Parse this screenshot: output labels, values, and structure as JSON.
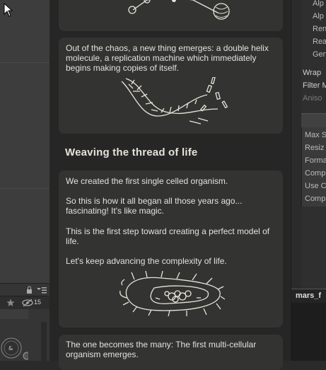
{
  "cards": {
    "dna": {
      "text": "Out of the chaos, a new thing emerges: a double helix molecule, a replication machine which immediately begins making copies of itself."
    },
    "section_heading": "Weaving the thread of life",
    "cell": {
      "p1": "We created the first single celled organism.",
      "p2": "So this is how it all began all those years ago... fascinating! It's like magic.",
      "p3": "This is the first step toward creating a perfect model of life.",
      "p4": "Let's keep advancing the complexity of life."
    },
    "multicell": {
      "text": "The one becomes the many: The first multi-cellular organism emerges."
    }
  },
  "left_panel": {
    "count": "15"
  },
  "inspector": {
    "rows_top": [
      "Alp",
      "Alp",
      "Ren",
      "Rea",
      "Gen"
    ],
    "wrap": "Wrap",
    "filter": "Filter M",
    "aniso": "Aniso",
    "rows_box": [
      "Max S",
      "Resiz",
      "Forma",
      "Comp",
      "Use C",
      "Comp"
    ],
    "tab_title": "mars_f"
  }
}
